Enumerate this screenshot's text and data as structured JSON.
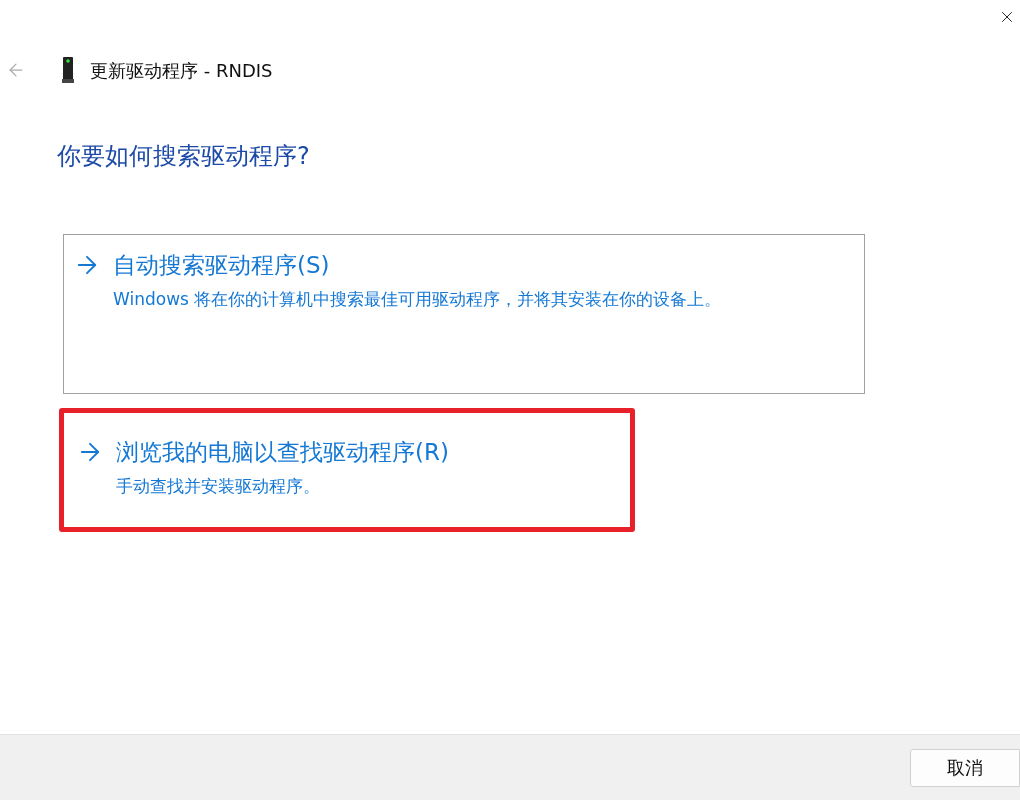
{
  "window": {
    "title": "更新驱动程序 - RNDIS"
  },
  "heading": "你要如何搜索驱动程序?",
  "options": [
    {
      "title": "自动搜索驱动程序(S)",
      "description": "Windows 将在你的计算机中搜索最佳可用驱动程序，并将其安装在你的设备上。",
      "selected": true,
      "highlighted": false
    },
    {
      "title": "浏览我的电脑以查找驱动程序(R)",
      "description": "手动查找并安装驱动程序。",
      "selected": false,
      "highlighted": true
    }
  ],
  "buttons": [
    "取消"
  ]
}
